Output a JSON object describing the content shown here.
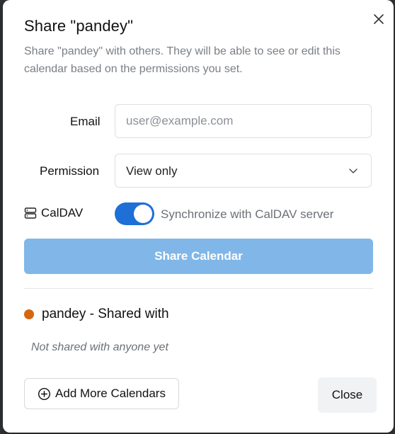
{
  "dialog": {
    "title": "Share \"pandey\"",
    "subtitle": "Share \"pandey\" with others. They will be able to see or edit this calendar based on the permissions you set.",
    "close_icon": "close-icon"
  },
  "form": {
    "email_label": "Email",
    "email_placeholder": "user@example.com",
    "email_value": "",
    "permission_label": "Permission",
    "permission_value": "View only",
    "caldav_label": "CalDAV",
    "caldav_icon": "server-icon",
    "caldav_sync_text": "Synchronize with CalDAV server",
    "caldav_enabled": true,
    "share_button": "Share Calendar"
  },
  "shared": {
    "heading": "pandey - Shared with",
    "calendar_color": "#d4670d",
    "empty_text": "Not shared with anyone yet"
  },
  "footer": {
    "add_more_label": "Add More Calendars",
    "add_more_icon": "plus-circle-icon",
    "close_label": "Close"
  },
  "colors": {
    "toggle_on": "#1e6fd6",
    "share_button_bg": "#80b7e8"
  }
}
